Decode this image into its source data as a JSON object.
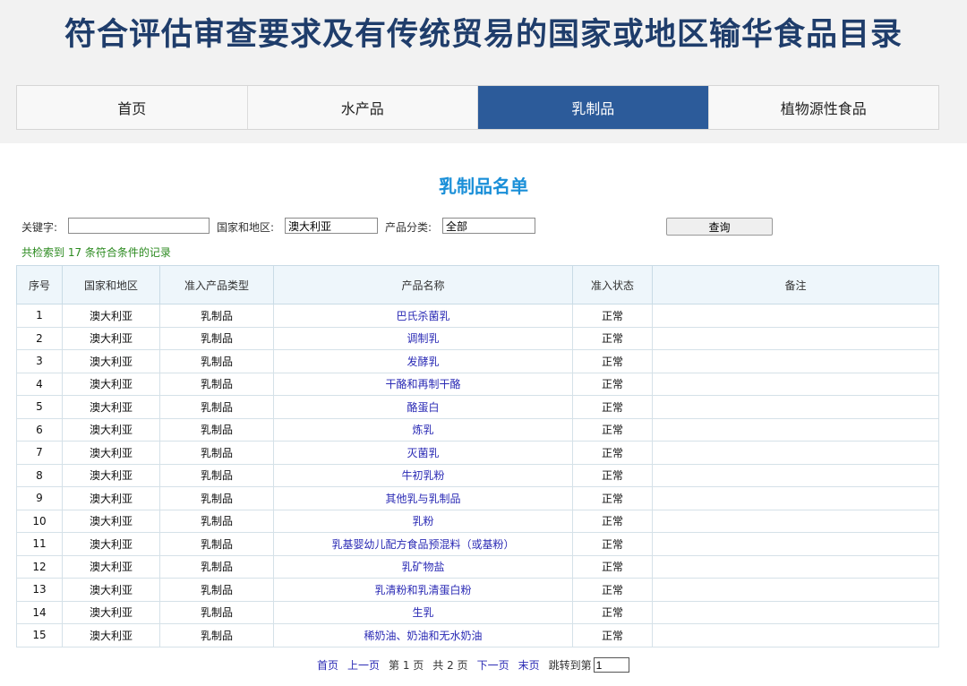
{
  "header": {
    "title": "符合评估审查要求及有传统贸易的国家或地区输华食品目录"
  },
  "nav": {
    "tabs": [
      "首页",
      "水产品",
      "乳制品",
      "植物源性食品"
    ],
    "active_index": 2
  },
  "list_title": "乳制品名单",
  "search": {
    "keyword_label": "关键字:",
    "keyword_value": "",
    "country_label": "国家和地区:",
    "country_value": "澳大利亚",
    "category_label": "产品分类:",
    "category_value": "全部",
    "query_button": "查询"
  },
  "result_count": "共检索到 17 条符合条件的记录",
  "table": {
    "headers": [
      "序号",
      "国家和地区",
      "准入产品类型",
      "产品名称",
      "准入状态",
      "备注"
    ],
    "rows": [
      [
        "1",
        "澳大利亚",
        "乳制品",
        "巴氏杀菌乳",
        "正常",
        ""
      ],
      [
        "2",
        "澳大利亚",
        "乳制品",
        "调制乳",
        "正常",
        ""
      ],
      [
        "3",
        "澳大利亚",
        "乳制品",
        "发酵乳",
        "正常",
        ""
      ],
      [
        "4",
        "澳大利亚",
        "乳制品",
        "干酪和再制干酪",
        "正常",
        ""
      ],
      [
        "5",
        "澳大利亚",
        "乳制品",
        "酪蛋白",
        "正常",
        ""
      ],
      [
        "6",
        "澳大利亚",
        "乳制品",
        "炼乳",
        "正常",
        ""
      ],
      [
        "7",
        "澳大利亚",
        "乳制品",
        "灭菌乳",
        "正常",
        ""
      ],
      [
        "8",
        "澳大利亚",
        "乳制品",
        "牛初乳粉",
        "正常",
        ""
      ],
      [
        "9",
        "澳大利亚",
        "乳制品",
        "其他乳与乳制品",
        "正常",
        ""
      ],
      [
        "10",
        "澳大利亚",
        "乳制品",
        "乳粉",
        "正常",
        ""
      ],
      [
        "11",
        "澳大利亚",
        "乳制品",
        "乳基婴幼儿配方食品预混料（或基粉）",
        "正常",
        ""
      ],
      [
        "12",
        "澳大利亚",
        "乳制品",
        "乳矿物盐",
        "正常",
        ""
      ],
      [
        "13",
        "澳大利亚",
        "乳制品",
        "乳清粉和乳清蛋白粉",
        "正常",
        ""
      ],
      [
        "14",
        "澳大利亚",
        "乳制品",
        "生乳",
        "正常",
        ""
      ],
      [
        "15",
        "澳大利亚",
        "乳制品",
        "稀奶油、奶油和无水奶油",
        "正常",
        ""
      ]
    ]
  },
  "pager": {
    "first": "首页",
    "prev": "上一页",
    "current": "第 1 页",
    "total": "共 2 页",
    "next": "下一页",
    "last": "末页",
    "jump_label": "跳转到第",
    "jump_value": "1"
  },
  "colors": {
    "nav_active": "#2c5b9a",
    "title": "#1f3d6b",
    "list_title": "#1a8fd8",
    "link": "#2b2bb5",
    "count": "#2b8a1f"
  }
}
